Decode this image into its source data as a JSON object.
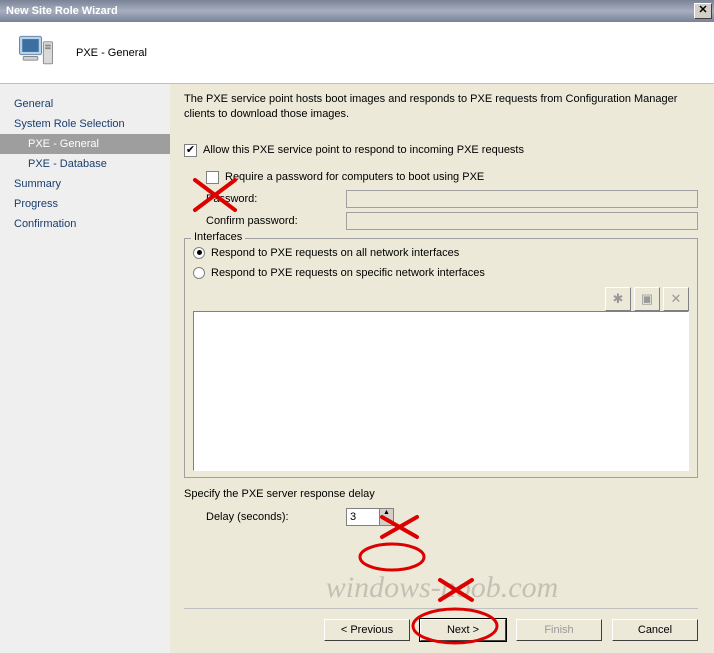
{
  "window": {
    "title": "New Site Role Wizard"
  },
  "header": {
    "page_title": "PXE - General"
  },
  "nav": {
    "items": [
      {
        "label": "General"
      },
      {
        "label": "System Role Selection"
      },
      {
        "label": "PXE - General"
      },
      {
        "label": "PXE - Database"
      },
      {
        "label": "Summary"
      },
      {
        "label": "Progress"
      },
      {
        "label": "Confirmation"
      }
    ]
  },
  "content": {
    "description": "The PXE service point hosts boot images and responds to PXE requests from Configuration Manager clients to download those images.",
    "allow_label": "Allow this PXE service point to respond to incoming PXE requests",
    "allow_checked": true,
    "require_pw_label": "Require a password for computers to boot using PXE",
    "require_pw_checked": false,
    "password_label": "Password:",
    "confirm_label": "Confirm password:",
    "interfaces": {
      "legend": "Interfaces",
      "opt_all": "Respond to PXE requests on all network interfaces",
      "opt_specific": "Respond to PXE requests on specific network interfaces",
      "selected": "all"
    },
    "delay_section_label": "Specify the PXE server response delay",
    "delay_label": "Delay (seconds):",
    "delay_value": "3"
  },
  "buttons": {
    "previous": "< Previous",
    "next": "Next >",
    "finish": "Finish",
    "cancel": "Cancel"
  },
  "watermark": "windows-noob.com"
}
